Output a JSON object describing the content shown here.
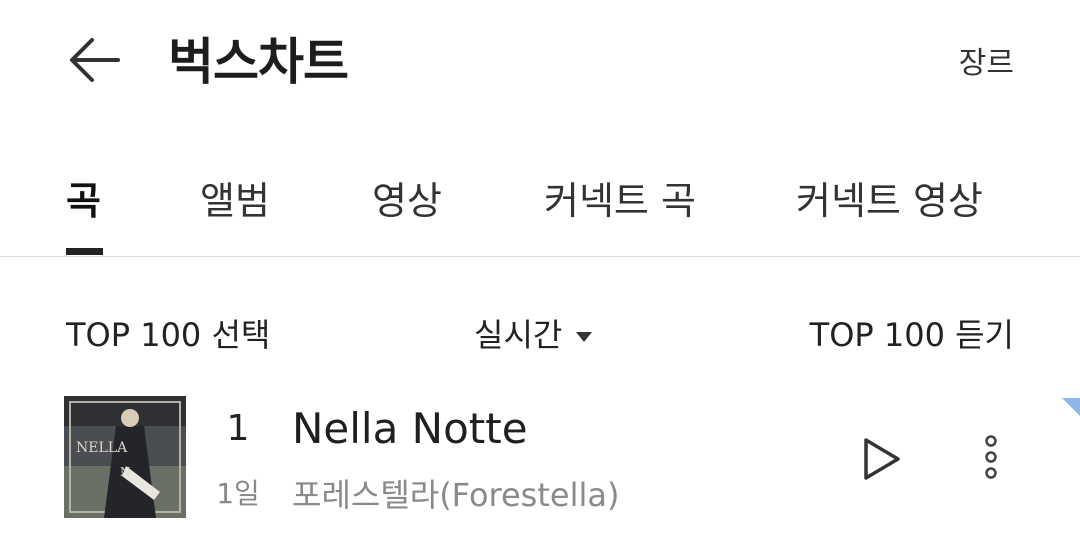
{
  "header": {
    "title": "벅스차트",
    "genre_label": "장르",
    "back_icon": "arrow-left-icon"
  },
  "tabs": [
    {
      "label": "곡",
      "active": true
    },
    {
      "label": "앨범",
      "active": false
    },
    {
      "label": "영상",
      "active": false
    },
    {
      "label": "커넥트 곡",
      "active": false
    },
    {
      "label": "커넥트 영상",
      "active": false
    }
  ],
  "controls": {
    "select_label": "TOP 100 선택",
    "period_label": "실시간",
    "period_icon": "caret-down-icon",
    "listen_label": "TOP 100 듣기"
  },
  "chart": {
    "rows": [
      {
        "rank": "1",
        "days": "1일",
        "title": "Nella Notte",
        "artist": "포레스텔라(Forestella)",
        "play_icon": "play-icon",
        "more_icon": "more-vertical-icon"
      }
    ]
  },
  "colors": {
    "accent_corner": "#8fb6e8",
    "text_primary": "#222222",
    "text_secondary": "#8a8a8a"
  }
}
